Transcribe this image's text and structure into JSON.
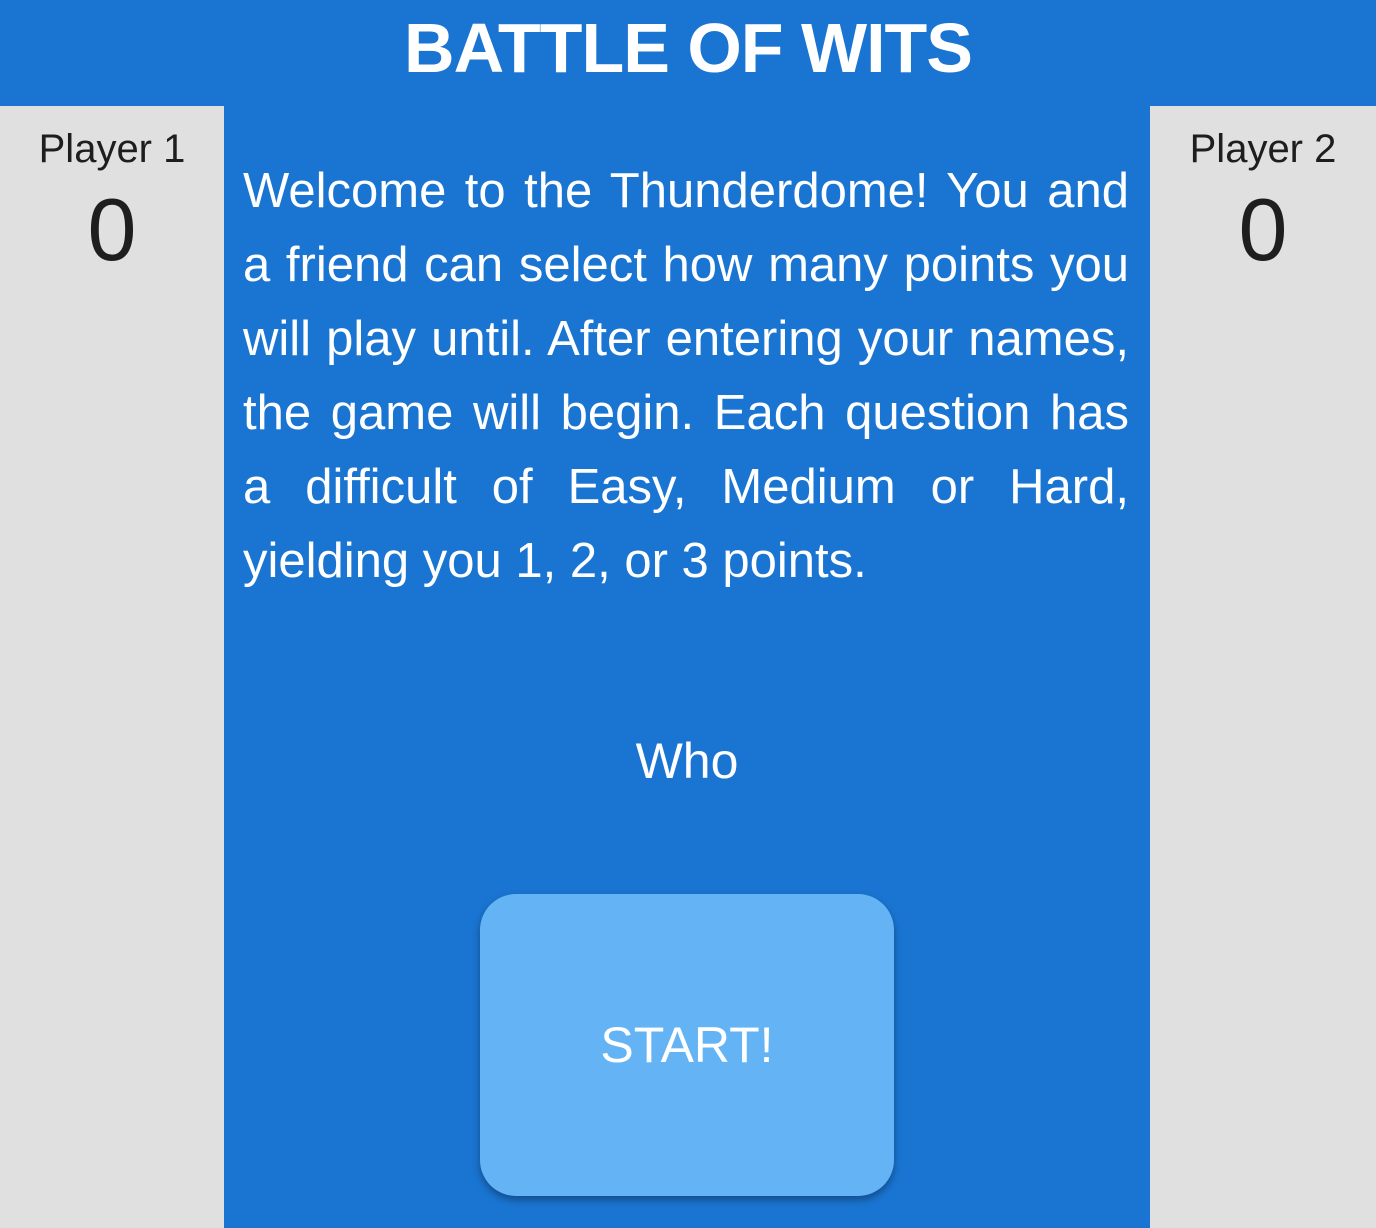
{
  "header": {
    "title": "BATTLE OF WITS"
  },
  "player1": {
    "label": "Player 1",
    "score": "0"
  },
  "player2": {
    "label": "Player 2",
    "score": "0"
  },
  "main": {
    "intro_text": "Welcome to the Thunderdome! You and a friend can select how many points you will play until. After entering your names, the game will begin. Each question has a difficult of Easy, Medium or Hard, yielding you 1, 2, or 3 points.",
    "prompt": "Who",
    "start_label": "START!"
  },
  "colors": {
    "primary": "#1a75d2",
    "side_panel": "#e0e0e0",
    "button": "#64b4f5",
    "text_light": "#ffffff",
    "text_dark": "#1e1e1e"
  }
}
